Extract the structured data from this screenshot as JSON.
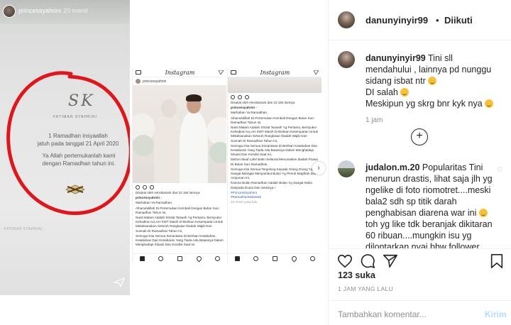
{
  "story": {
    "username": "princessyahrini",
    "time": "20 menit",
    "brand": "FATIMAH SYAHRINI",
    "line1": "1 Ramadhan insyaallah",
    "line2": "jatuh pada tanggal 21 April 2020",
    "line3": "Ya Allah pertemukanlah kami",
    "line4": "dengan Ramadhan tahun ini.",
    "footer": "FATIMAH SYAHRINI"
  },
  "shot2": {
    "app": "Instagram",
    "username": "princessyahrini",
    "liked_by": "Disukai oleh reinobarack dan 22.184 lainnya",
    "caption_user": "princessyahrini -",
    "caption": [
      "Marhaban Ya Ramadhan,",
      "Alhamdulillah Di Pertemukan Kembali Dengan Bulan Suci Ramadhan Tahun Ini,",
      "Nanti Malam Adalah Sholat Tarawih Yg Pertama, Bersyukur Kehadirat ALLAH SWT Masih Di Berikan Kesempatan Untuk Melaksanakan Seluruh Rangkaian Ibadah Wajib Dan Sunnah Di Ramadhan Tahun Ini,",
      "Semoga Kita Semua Senantiasa Di Berikan Ketabahan, Ketabahan Dan Kesabaran Yang Tiada Ada Batasnya Dalam Menghadapi Situasi Dan Kondisi Saat Ini,"
    ]
  },
  "shot3": {
    "app": "Instagram",
    "liked_by": "Disukai oleh reinobarack dan 22.184 lainnya",
    "caption_user": "princessyahrini -",
    "caption": [
      "Marhaban Ya Ramadhan,",
      "Alhamdulillah Di Pertemukan Kembali Dengan Bulan Suci Ramadhan Tahun Ini,",
      "Nanti Malam Adalah Sholat Tarawih Yg Pertama, Bersyukur Kehadirat ALLAH SWT Masih Di Berikan Kesempatan Untuk Melaksanakan Seluruh Rangkaian Ibadah Wajib Dan Sunnah Di Ramadhan Tahun Ini,",
      "Semoga Kita Semua Senantiasa Di Berikan Ketabahan Dan Kesabaran Yang Tiada Ada Batasnya Dalam Menghadapi Situasi Dan Kondisi Saat Ini,",
      "Mohon Maaf Lahir Batin Selamat Menunaikan Ibadah Puasa Di Bulan Suci Ramadhan,",
      "Semoga Kita Semua Tergolong Kepada Orang Orang Yg Sangat Bahagia Menyambut Bulan Yg Penuh Magfirah Dan Ampunan Ini,",
      "Karena Bulan Ramadhan Adalah Bulan Yg Sangat Mulia Daripada Dunia Dan Seisinya !"
    ],
    "tags": "#PrincessSyahrini\n#RamadhanMubarak",
    "ago": "22 menit yang lalu"
  },
  "panel": {
    "username": "danunyinyir99",
    "separator": "•",
    "follow_label": "Diikuti",
    "comments": [
      {
        "user": "danunyinyir99",
        "text_a": "Tini sll mendahului , lainnya pd nunggu sidang isbat ntr",
        "text_b": "DI salah",
        "text_c": "Meskipun yg skrg bnr kyk nya",
        "time": "1 jam"
      },
      {
        "user": "judalon.m.20",
        "text": "Popularitas Tini menurun drastis, lihat saja jlh yg ngelike di foto riomotret....meski bala2 sdh sp titik darah penghabisan diarena war ini",
        "text2": "toh yg like tdk beranjak dikitaran 60 ribuan....mungkin isu yg dilontarkan nyai bhw follower dapet beli sangatlah"
      }
    ],
    "likes": "123 suka",
    "date": "1 JAM YANG LALU",
    "comment_placeholder": "Tambahkan komentar...",
    "post_label": "Kirim"
  },
  "below": {
    "text": "Ramadhan"
  },
  "colors": {
    "red_circle": "#e0161d",
    "link_blue": "#b3dbff",
    "muted": "#8e8e8e"
  }
}
